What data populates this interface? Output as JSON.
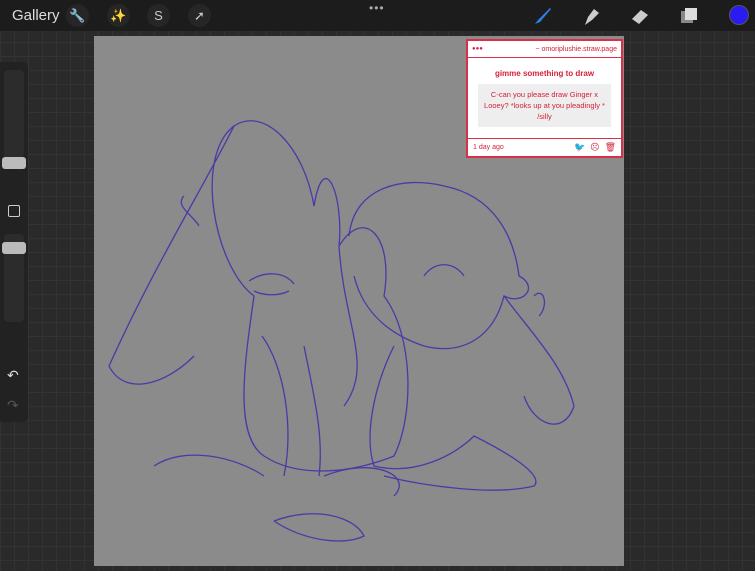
{
  "topbar": {
    "gallery_label": "Gallery",
    "tools": [
      "wrench-icon",
      "magic-wand-icon",
      "selection-icon",
      "transform-arrow-icon"
    ],
    "more": "•••",
    "right_tools": [
      "brush-icon",
      "smudge-icon",
      "eraser-icon",
      "layers-icon"
    ],
    "current_color": "#2a1cf0"
  },
  "card": {
    "dots": "●●●",
    "site": "~ omoriplushie.straw.page",
    "title": "gimme something to draw",
    "message": "C-can you please draw Ginger x Looey? *looks up at you pleadingly * /silly",
    "time": "1 day ago",
    "accent": "#d93048"
  },
  "sidebar": {
    "undo": "↶",
    "redo": "↷"
  }
}
